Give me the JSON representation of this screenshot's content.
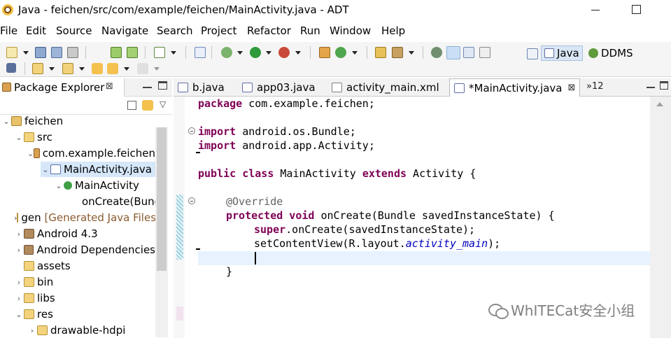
{
  "window": {
    "title": "Java - feichen/src/com/example/feichen/MainActivity.java - ADT"
  },
  "menu": [
    "File",
    "Edit",
    "Source",
    "Navigate",
    "Search",
    "Project",
    "Refactor",
    "Run",
    "Window",
    "Help"
  ],
  "perspectives": {
    "java": "Java",
    "ddms": "DDMS"
  },
  "package_explorer": {
    "title": "Package Explorer",
    "close_glyph": "⊠",
    "tree": [
      {
        "label": "feichen",
        "icon": "project-icon",
        "twisty": "⌄"
      },
      {
        "label": "src",
        "icon": "source-folder-icon",
        "twisty": "⌄"
      },
      {
        "label": "com.example.feichen",
        "icon": "package-icon",
        "twisty": "⌄"
      },
      {
        "label": "MainActivity.java",
        "icon": "java-file-icon",
        "twisty": "⌄"
      },
      {
        "label": "MainActivity",
        "icon": "class-icon",
        "twisty": "⌄"
      },
      {
        "label": "onCreate(Bundle)",
        "icon": "method-icon",
        "twisty": ""
      },
      {
        "label": "gen",
        "decoration": "[Generated Java Files]",
        "icon": "source-folder-icon",
        "twisty": "›"
      },
      {
        "label": "Android 4.3",
        "icon": "library-icon",
        "twisty": "›"
      },
      {
        "label": "Android Dependencies",
        "icon": "library-icon",
        "twisty": "›"
      },
      {
        "label": "assets",
        "icon": "folder-icon",
        "twisty": ""
      },
      {
        "label": "bin",
        "icon": "folder-icon",
        "twisty": "›"
      },
      {
        "label": "libs",
        "icon": "folder-icon",
        "twisty": "›"
      },
      {
        "label": "res",
        "icon": "folder-icon",
        "twisty": "⌄"
      },
      {
        "label": "drawable-hdpi",
        "icon": "folder-icon",
        "twisty": "›"
      }
    ]
  },
  "editor_tabs": [
    {
      "label": "b.java",
      "icon": "java-file-icon",
      "active": false
    },
    {
      "label": "app03.java",
      "icon": "java-file-icon",
      "active": false
    },
    {
      "label": "activity_main.xml",
      "icon": "xml-file-icon",
      "active": false
    },
    {
      "label": "*MainActivity.java",
      "icon": "java-file-icon",
      "active": true,
      "close_glyph": "⊠"
    }
  ],
  "overflow_tabs": "»12",
  "code": {
    "l1_kw": "package",
    "l1_rest": " com.example.feichen;",
    "l2_kw": "import",
    "l2_rest": " android.os.Bundle;",
    "l3_kw": "import",
    "l3_rest": " android.app.Activity;",
    "l4_kw1": "public class",
    "l4_mid": " MainActivity ",
    "l4_kw2": "extends",
    "l4_rest": " Activity {",
    "l5_ann": "@Override",
    "l6_kw": "protected void",
    "l6_rest": " onCreate(Bundle savedInstanceState) {",
    "l7_kw": "super",
    "l7_rest": ".onCreate(savedInstanceState);",
    "l8_pre": "setContentView(R.layout.",
    "l8_field": "activity_main",
    "l8_post": ");",
    "l10": "}"
  },
  "watermark": "WhITECat安全小组",
  "colors": {
    "keyword": "#7f0055",
    "annotation": "#646464",
    "field": "#0000c0",
    "selection": "#d5e7f9",
    "current_line": "#e8f2fe"
  }
}
